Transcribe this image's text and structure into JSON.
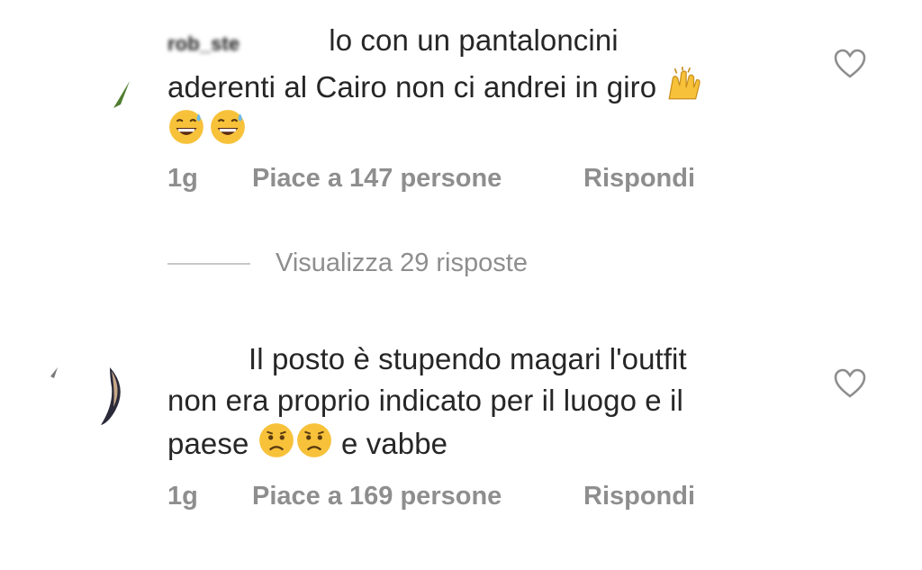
{
  "comments": [
    {
      "username": "rob_ste",
      "text_line1": "lo con un pantaloncini",
      "text_line2": "aderenti al Cairo non ci andrei in giro",
      "emoji": [
        "raising-hands-icon",
        "grinning-sweat-icon",
        "grinning-sweat-icon"
      ],
      "time": "1g",
      "likes": "Piace a 147 persone",
      "reply": "Rispondi"
    },
    {
      "username": "",
      "text_line1": "Il posto è stupendo magari l'outfit",
      "text_line2": "non era proprio indicato per il luogo e il",
      "text_line3_a": "paese",
      "text_line3_b": "e vabbe",
      "emoji": [
        "worried-face-icon",
        "worried-face-icon"
      ],
      "time": "1g",
      "likes": "Piace a 169 persone",
      "reply": "Rispondi"
    }
  ],
  "view_replies": "Visualizza 29 risposte",
  "colors": {
    "text": "#262626",
    "muted": "#8e8e8e",
    "divider": "#c7c7c7",
    "emoji_yellow": "#f7c23a"
  }
}
